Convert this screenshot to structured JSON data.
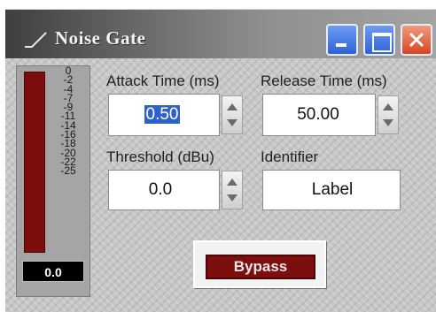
{
  "window": {
    "title": "Noise Gate",
    "controls": [
      "minimize",
      "maximize",
      "close"
    ]
  },
  "meter": {
    "ticks": [
      "0",
      "-2",
      "-4",
      "-7",
      "-9",
      "-11",
      "-14",
      "-16",
      "-18",
      "-20",
      "-22",
      "-25"
    ],
    "readout": "0.0"
  },
  "fields": {
    "attack_label": "Attack Time (ms)",
    "attack_value": "0.50",
    "release_label": "Release Time (ms)",
    "release_value": "50.00",
    "threshold_label": "Threshold (dBu)",
    "threshold_value": "0.0",
    "identifier_label": "Identifier",
    "identifier_value": "Label"
  },
  "bypass": {
    "label": "Bypass"
  },
  "colors": {
    "meter": "#7c0e0e",
    "bypass": "#7c0e0e",
    "selection": "#2f62c8",
    "titlebar_buttons": "#3a6ee0",
    "close_button": "#e05a32"
  }
}
